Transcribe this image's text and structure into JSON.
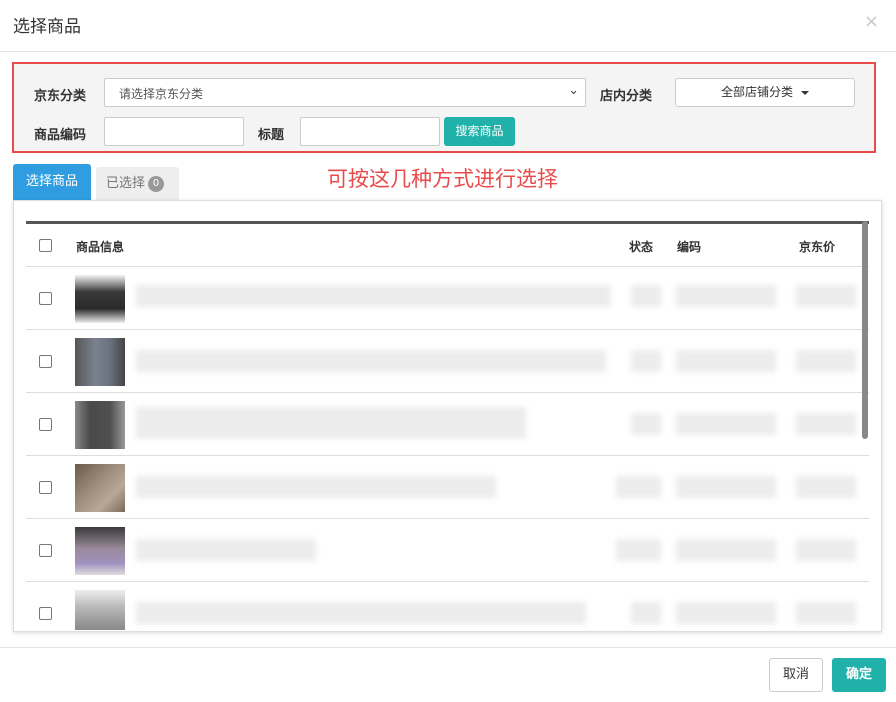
{
  "modal": {
    "title": "选择商品",
    "close_glyph": "×"
  },
  "filters": {
    "jd_category_label": "京东分类",
    "jd_category_placeholder": "请选择京东分类",
    "shop_category_label": "店内分类",
    "shop_category_value": "全部店铺分类",
    "product_code_label": "商品编码",
    "title_label": "标题",
    "search_button": "搜索商品"
  },
  "tabs": {
    "select_products": "选择商品",
    "selected": "已选择",
    "selected_count": "0"
  },
  "annotation": "可按这几种方式进行选择",
  "table": {
    "columns": {
      "info": "商品信息",
      "status": "状态",
      "code": "编码",
      "price": "京东价"
    },
    "rows_visible": 6
  },
  "footer": {
    "cancel": "取消",
    "confirm": "确定"
  },
  "colors": {
    "accent_teal": "#20b2aa",
    "tab_blue": "#2f9de0",
    "annotation_red": "#e84b4b"
  },
  "icons": {
    "close": "close-icon",
    "select_caret": "chevron-down-icon",
    "dropdown": "caret-down-icon"
  }
}
